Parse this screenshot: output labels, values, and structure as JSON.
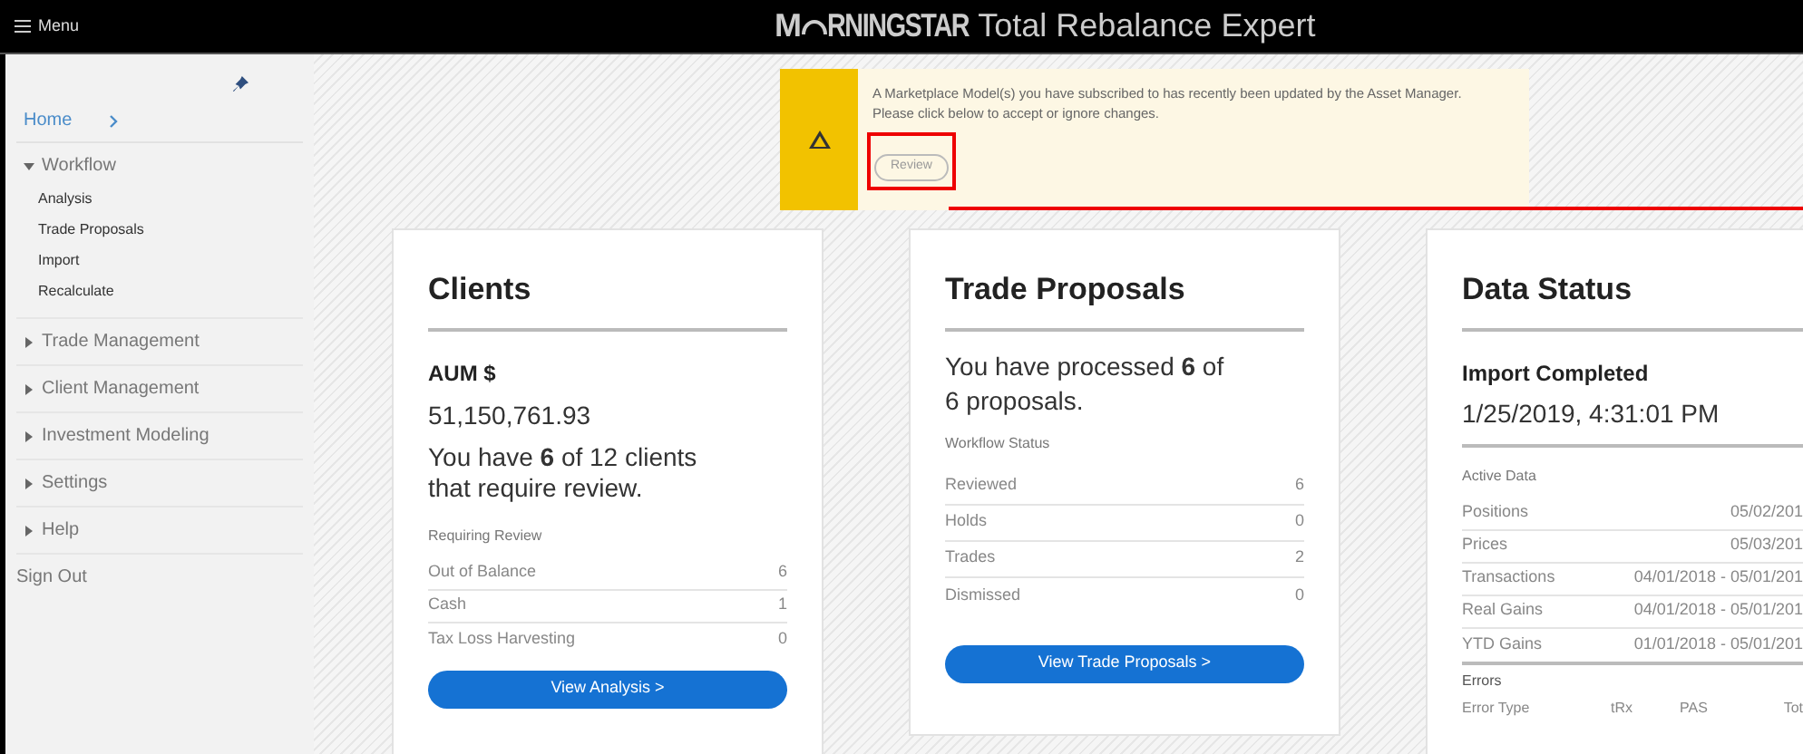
{
  "header": {
    "menu_label": "Menu",
    "logo_start": "M",
    "logo_end": "RNINGSTAR",
    "product": "Total Rebalance Expert"
  },
  "sidebar": {
    "items": [
      {
        "label": "Home",
        "kind": "link"
      },
      {
        "label": "Workflow",
        "kind": "group",
        "expanded": true,
        "children": [
          {
            "label": "Analysis"
          },
          {
            "label": "Trade Proposals"
          },
          {
            "label": "Import"
          },
          {
            "label": "Recalculate"
          }
        ]
      },
      {
        "label": "Trade Management",
        "kind": "group",
        "expanded": false
      },
      {
        "label": "Client Management",
        "kind": "group",
        "expanded": false
      },
      {
        "label": "Investment Modeling",
        "kind": "group",
        "expanded": false
      },
      {
        "label": "Settings",
        "kind": "group",
        "expanded": false
      },
      {
        "label": "Help",
        "kind": "group",
        "expanded": false
      },
      {
        "label": "Sign Out",
        "kind": "plain"
      }
    ]
  },
  "notice": {
    "message": "A Marketplace Model(s) you have subscribed to has recently been updated by the Asset Manager. Please click below to accept or ignore changes.",
    "button": "Review",
    "highlighted": true
  },
  "clients": {
    "title": "Clients",
    "aum_label": "AUM $",
    "aum_value": "51,150,761.93",
    "summary": "You have **6** of 12 clients that require review.",
    "section": "Requiring Review",
    "rows": [
      {
        "label": "Out of Balance",
        "value": "6"
      },
      {
        "label": "Cash",
        "value": "1"
      },
      {
        "label": "Tax Loss Harvesting",
        "value": "0"
      }
    ],
    "button": "View Analysis >"
  },
  "trade_proposals": {
    "title": "Trade Proposals",
    "summary": "You have processed **6** of 6 proposals.",
    "section": "Workflow Status",
    "rows": [
      {
        "label": "Reviewed",
        "value": "6"
      },
      {
        "label": "Holds",
        "value": "0"
      },
      {
        "label": "Trades",
        "value": "2"
      },
      {
        "label": "Dismissed",
        "value": "0"
      }
    ],
    "button": "View Trade Proposals >"
  },
  "data_status": {
    "title": "Data Status",
    "import_label": "Import Completed",
    "import_time": "1/25/2019, 4:31:01 PM",
    "section": "Active Data",
    "rows": [
      {
        "label": "Positions",
        "value": "05/02/201"
      },
      {
        "label": "Prices",
        "value": "05/03/201"
      },
      {
        "label": "Transactions",
        "value": "04/01/2018 - 05/01/201"
      },
      {
        "label": "Real Gains",
        "value": "04/01/2018 - 05/01/201"
      },
      {
        "label": "YTD Gains",
        "value": "01/01/2018 - 05/01/201"
      }
    ],
    "errors_label": "Errors",
    "error_columns": [
      "Error Type",
      "tRx",
      "PAS",
      "Tot"
    ]
  }
}
